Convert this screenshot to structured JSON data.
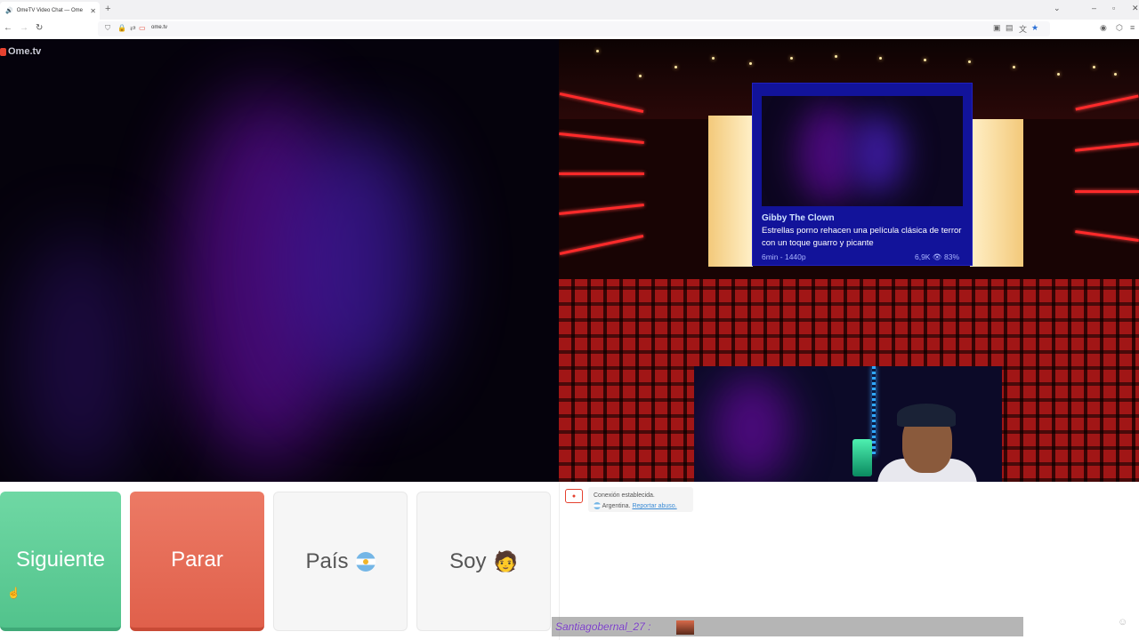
{
  "browser": {
    "tab_title": "OmeTV Video Chat — Ome",
    "url": "ome.tv"
  },
  "logo": {
    "text": "Ome.tv"
  },
  "video_card": {
    "title": "Gibby The Clown",
    "description": "Estrellas porno rehacen una película clásica de terror con un toque guarro y picante",
    "meta": "6min - 1440p",
    "stats": "6,9K 👁 83%"
  },
  "controls": {
    "next_label": "Siguiente",
    "stop_label": "Parar",
    "country_label": "País",
    "soy_label": "Soy"
  },
  "chat": {
    "status": "Conexión establecida.",
    "country": "Argentina.",
    "report_link": "Reportar abuso."
  },
  "overlay": {
    "username": "Santiagobernal_27 :"
  },
  "icons": {
    "tab_audio": "speaker-icon",
    "flag": "argentina-flag-icon",
    "soy_face": "face-emoji-icon"
  }
}
